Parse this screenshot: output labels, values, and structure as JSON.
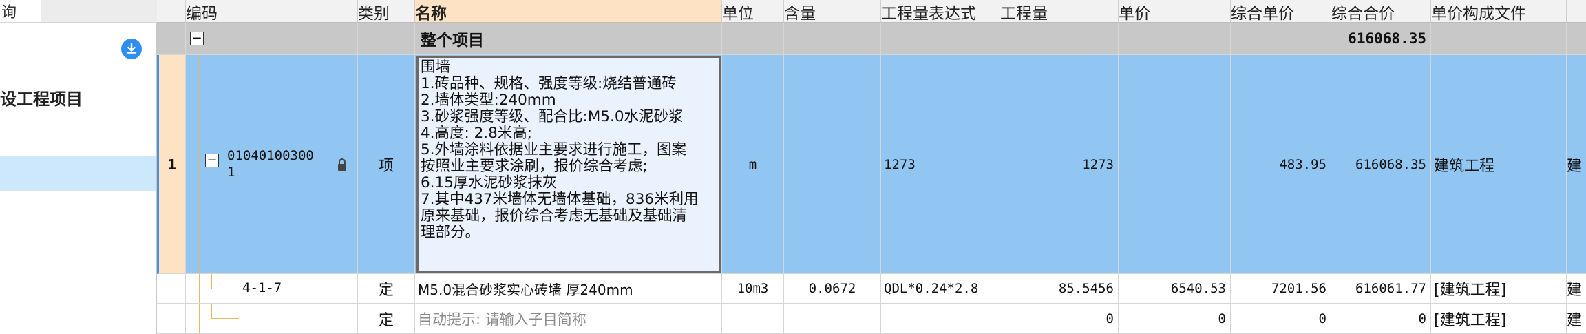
{
  "left_panel": {
    "query_tab": "询",
    "project_name": "设工程项目"
  },
  "columns": [
    "编码",
    "类别",
    "名称",
    "单位",
    "含量",
    "工程量表达式",
    "工程量",
    "单价",
    "综合单价",
    "综合合价",
    "单价构成文件"
  ],
  "rows": {
    "project": {
      "name": "整个项目",
      "total": "616068.35"
    },
    "item": {
      "seq": "1",
      "code_line1": "01040100300",
      "code_line2": "1",
      "category": "项",
      "description_lines": [
        "围墙",
        "1.砖品种、规格、强度等级:烧结普通砖",
        "2.墙体类型:240mm",
        "3.砂浆强度等级、配合比:M5.0水泥砂浆",
        "4.高度: 2.8米高;",
        "5.外墙涂料依据业主要求进行施工，图案",
        "按照业主要求涂刷，报价综合考虑;",
        "6.15厚水泥砂浆抹灰",
        "7.其中437米墙体无墙体基础，836米利用",
        "原来基础，报价综合考虑无基础及基础清",
        "理部分。"
      ],
      "unit": "m",
      "expr": "1273",
      "qty": "1273",
      "comp_price": "483.95",
      "comp_total": "616068.35",
      "price_file": "建筑工程",
      "overflow": "建"
    },
    "sub": {
      "code": "4-1-7",
      "category": "定",
      "name": "M5.0混合砂浆实心砖墙 厚240mm",
      "unit": "10m3",
      "content": "0.0672",
      "expr": "QDL*0.24*2.8",
      "qty": "85.5456",
      "price": "6540.53",
      "comp_price": "7201.56",
      "comp_total": "616061.77",
      "price_file": "[建筑工程]",
      "overflow": "建"
    },
    "new": {
      "category": "定",
      "hint": "自动提示: 请输入子目简称",
      "qty": "0",
      "price": "0",
      "comp_price": "0",
      "comp_total": "0",
      "price_file": "[建筑工程]",
      "overflow": "建"
    }
  },
  "icons": {
    "download": "download-circle-icon",
    "lock": "lock-icon"
  },
  "colors": {
    "header_active": "#fde2c4",
    "selected_row": "#92c6f2",
    "project_row": "#c8c8c8",
    "accent": "#2f8ff0"
  }
}
